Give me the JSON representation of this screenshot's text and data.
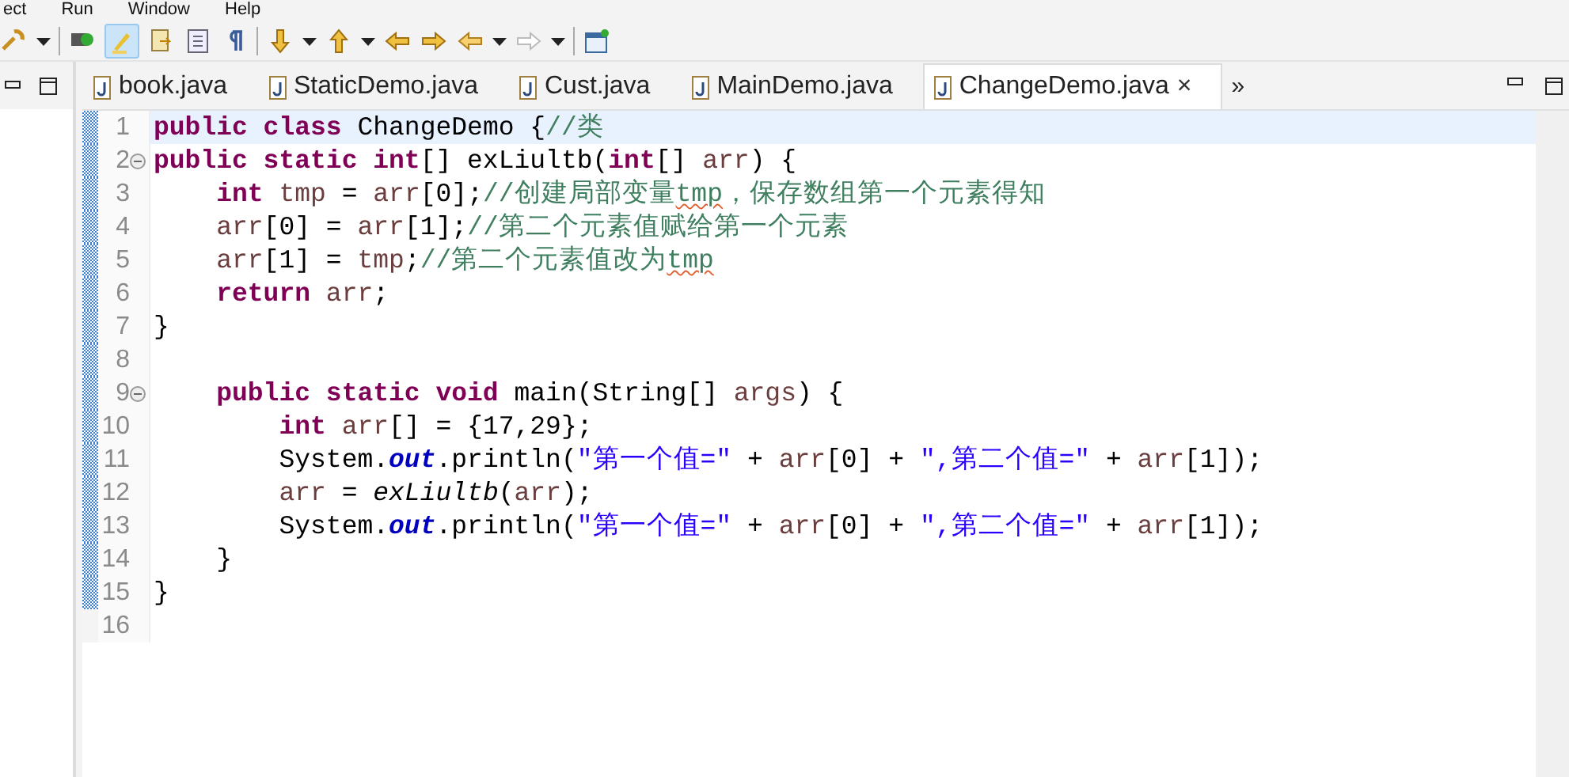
{
  "menu": [
    "ect",
    "Run",
    "Window",
    "Help"
  ],
  "toolbar": {
    "toggle_selected": true
  },
  "tabs": [
    {
      "label": "book.java",
      "selected": false
    },
    {
      "label": "StaticDemo.java",
      "selected": false
    },
    {
      "label": "Cust.java",
      "selected": false
    },
    {
      "label": "MainDemo.java",
      "selected": false
    },
    {
      "label": "ChangeDemo.java",
      "selected": true,
      "close": "×"
    }
  ],
  "tab_overflow": "»",
  "lines": [
    {
      "number": "1",
      "fold": false,
      "current": true,
      "in_range": true,
      "tokens": [
        {
          "kind": "kw",
          "text": "public class"
        },
        {
          "kind": "plain",
          "text": " ChangeDemo {"
        },
        {
          "kind": "comment",
          "text": "//类"
        }
      ]
    },
    {
      "number": "2",
      "fold": true,
      "current": false,
      "in_range": true,
      "tokens": [
        {
          "kind": "kw",
          "text": "public static int"
        },
        {
          "kind": "plain",
          "text": "[] exLiultb("
        },
        {
          "kind": "kw",
          "text": "int"
        },
        {
          "kind": "plain",
          "text": "[] "
        },
        {
          "kind": "var",
          "text": "arr"
        },
        {
          "kind": "plain",
          "text": ") {"
        }
      ]
    },
    {
      "number": "3",
      "fold": false,
      "current": false,
      "in_range": true,
      "tokens": [
        {
          "kind": "kw",
          "text": "    int"
        },
        {
          "kind": "var",
          "text": " tmp"
        },
        {
          "kind": "plain",
          "text": " = "
        },
        {
          "kind": "var",
          "text": "arr"
        },
        {
          "kind": "plain",
          "text": "[0];"
        },
        {
          "kind": "comment",
          "text": "//创建局部变量"
        },
        {
          "kind": "warn",
          "text": "tmp"
        },
        {
          "kind": "comment",
          "text": "，保存数组第一个元素得知"
        }
      ]
    },
    {
      "number": "4",
      "fold": false,
      "current": false,
      "in_range": true,
      "tokens": [
        {
          "kind": "var",
          "text": "    arr"
        },
        {
          "kind": "plain",
          "text": "[0] = "
        },
        {
          "kind": "var",
          "text": "arr"
        },
        {
          "kind": "plain",
          "text": "[1];"
        },
        {
          "kind": "comment",
          "text": "//第二个元素值赋给第一个元素"
        }
      ]
    },
    {
      "number": "5",
      "fold": false,
      "current": false,
      "in_range": true,
      "tokens": [
        {
          "kind": "var",
          "text": "    arr"
        },
        {
          "kind": "plain",
          "text": "[1] = "
        },
        {
          "kind": "var",
          "text": "tmp"
        },
        {
          "kind": "plain",
          "text": ";"
        },
        {
          "kind": "comment",
          "text": "//第二个元素值改为"
        },
        {
          "kind": "warn",
          "text": "tmp"
        }
      ]
    },
    {
      "number": "6",
      "fold": false,
      "current": false,
      "in_range": true,
      "tokens": [
        {
          "kind": "kw",
          "text": "    return"
        },
        {
          "kind": "var",
          "text": " arr"
        },
        {
          "kind": "plain",
          "text": ";"
        }
      ]
    },
    {
      "number": "7",
      "fold": false,
      "current": false,
      "in_range": true,
      "tokens": [
        {
          "kind": "plain",
          "text": "}"
        }
      ]
    },
    {
      "number": "8",
      "fold": false,
      "current": false,
      "in_range": true
    },
    {
      "number": "9",
      "fold": true,
      "current": false,
      "in_range": true,
      "tokens": [
        {
          "kind": "kw",
          "text": "    public static void"
        },
        {
          "kind": "plain",
          "text": " main(String[] "
        },
        {
          "kind": "var",
          "text": "args"
        },
        {
          "kind": "plain",
          "text": ") {"
        }
      ]
    },
    {
      "number": "10",
      "fold": false,
      "current": false,
      "in_range": true,
      "tokens": [
        {
          "kind": "kw",
          "text": "        int"
        },
        {
          "kind": "var",
          "text": " arr"
        },
        {
          "kind": "plain",
          "text": "[] = {17,29};"
        }
      ]
    },
    {
      "number": "11",
      "fold": false,
      "current": false,
      "in_range": true,
      "tokens": [
        {
          "kind": "plain",
          "text": "        System."
        },
        {
          "kind": "field",
          "text": "out"
        },
        {
          "kind": "plain",
          "text": ".println("
        },
        {
          "kind": "string",
          "text": "\"第一个值=\""
        },
        {
          "kind": "plain",
          "text": " + "
        },
        {
          "kind": "var",
          "text": "arr"
        },
        {
          "kind": "plain",
          "text": "[0] + "
        },
        {
          "kind": "string",
          "text": "\",第二个值=\""
        },
        {
          "kind": "plain",
          "text": " + "
        },
        {
          "kind": "var",
          "text": "arr"
        },
        {
          "kind": "plain",
          "text": "[1]);"
        }
      ]
    },
    {
      "number": "12",
      "fold": false,
      "current": false,
      "in_range": true,
      "tokens": [
        {
          "kind": "var",
          "text": "        arr"
        },
        {
          "kind": "plain",
          "text": " = "
        },
        {
          "kind": "static",
          "text": "exLiultb"
        },
        {
          "kind": "plain",
          "text": "("
        },
        {
          "kind": "var",
          "text": "arr"
        },
        {
          "kind": "plain",
          "text": ");"
        }
      ]
    },
    {
      "number": "13",
      "fold": false,
      "current": false,
      "in_range": true,
      "tokens": [
        {
          "kind": "plain",
          "text": "        System."
        },
        {
          "kind": "field",
          "text": "out"
        },
        {
          "kind": "plain",
          "text": ".println("
        },
        {
          "kind": "string",
          "text": "\"第一个值=\""
        },
        {
          "kind": "plain",
          "text": " + "
        },
        {
          "kind": "var",
          "text": "arr"
        },
        {
          "kind": "plain",
          "text": "[0] + "
        },
        {
          "kind": "string",
          "text": "\",第二个值=\""
        },
        {
          "kind": "plain",
          "text": " + "
        },
        {
          "kind": "var",
          "text": "arr"
        },
        {
          "kind": "plain",
          "text": "[1]);"
        }
      ]
    },
    {
      "number": "14",
      "fold": false,
      "current": false,
      "in_range": true,
      "tokens": [
        {
          "kind": "plain",
          "text": "    }"
        }
      ]
    },
    {
      "number": "15",
      "fold": false,
      "current": false,
      "in_range": true,
      "tokens": [
        {
          "kind": "plain",
          "text": "}"
        }
      ]
    },
    {
      "number": "16",
      "fold": false,
      "current": false,
      "in_range": false
    }
  ]
}
